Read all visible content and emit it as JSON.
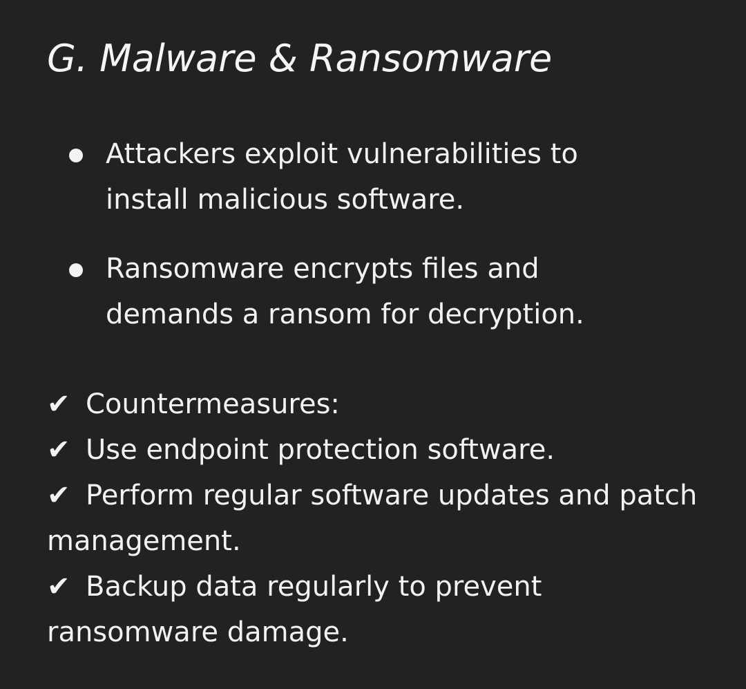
{
  "heading": "G. Malware & Ransomware",
  "bullets": [
    "Attackers exploit vulnerabilities to install malicious software.",
    "Ransomware encrypts files and demands a ransom for decryption."
  ],
  "countermeasures": [
    "Countermeasures:",
    "Use endpoint protection software.",
    "Perform regular software updates and patch management.",
    "Backup data regularly to prevent ransomware damage."
  ],
  "icons": {
    "check": "✔",
    "bullet": "bullet-dot-icon"
  },
  "colors": {
    "background": "#222222",
    "text": "#f2f2f2"
  }
}
